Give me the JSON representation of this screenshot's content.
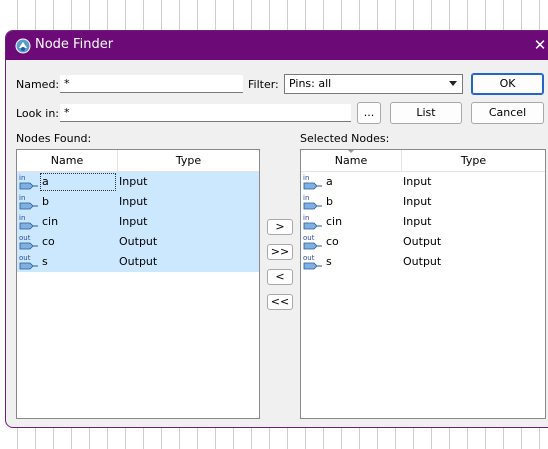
{
  "window": {
    "title": "Node Finder",
    "close_glyph": "✕"
  },
  "named": {
    "label": "Named:",
    "value": "*"
  },
  "filter": {
    "label": "Filter:",
    "value": "Pins: all"
  },
  "look_in": {
    "label": "Look in:",
    "value": "*",
    "browse_label": "..."
  },
  "buttons": {
    "ok": "OK",
    "cancel": "Cancel",
    "list": "List",
    "add": ">",
    "add_all": ">>",
    "remove": "<",
    "remove_all": "<<"
  },
  "nodes_found": {
    "label": "Nodes Found:",
    "columns": [
      "Name",
      "Type"
    ],
    "rows": [
      {
        "icon": "in",
        "name": "a",
        "type": "Input"
      },
      {
        "icon": "in",
        "name": "b",
        "type": "Input"
      },
      {
        "icon": "in",
        "name": "cin",
        "type": "Input"
      },
      {
        "icon": "out",
        "name": "co",
        "type": "Output"
      },
      {
        "icon": "out",
        "name": "s",
        "type": "Output"
      }
    ]
  },
  "selected_nodes": {
    "label": "Selected Nodes:",
    "columns": [
      "Name",
      "Type"
    ],
    "rows": [
      {
        "icon": "in",
        "name": "a",
        "type": "Input"
      },
      {
        "icon": "in",
        "name": "b",
        "type": "Input"
      },
      {
        "icon": "in",
        "name": "cin",
        "type": "Input"
      },
      {
        "icon": "out",
        "name": "co",
        "type": "Output"
      },
      {
        "icon": "out",
        "name": "s",
        "type": "Output"
      }
    ]
  },
  "colors": {
    "titlebar": "#6c0a78",
    "selection": "#cce8ff",
    "default_button_border": "#2266cc"
  },
  "icons": {
    "input_pin": "input-pin-icon",
    "output_pin": "output-pin-icon",
    "app": "node-finder-app-icon"
  }
}
